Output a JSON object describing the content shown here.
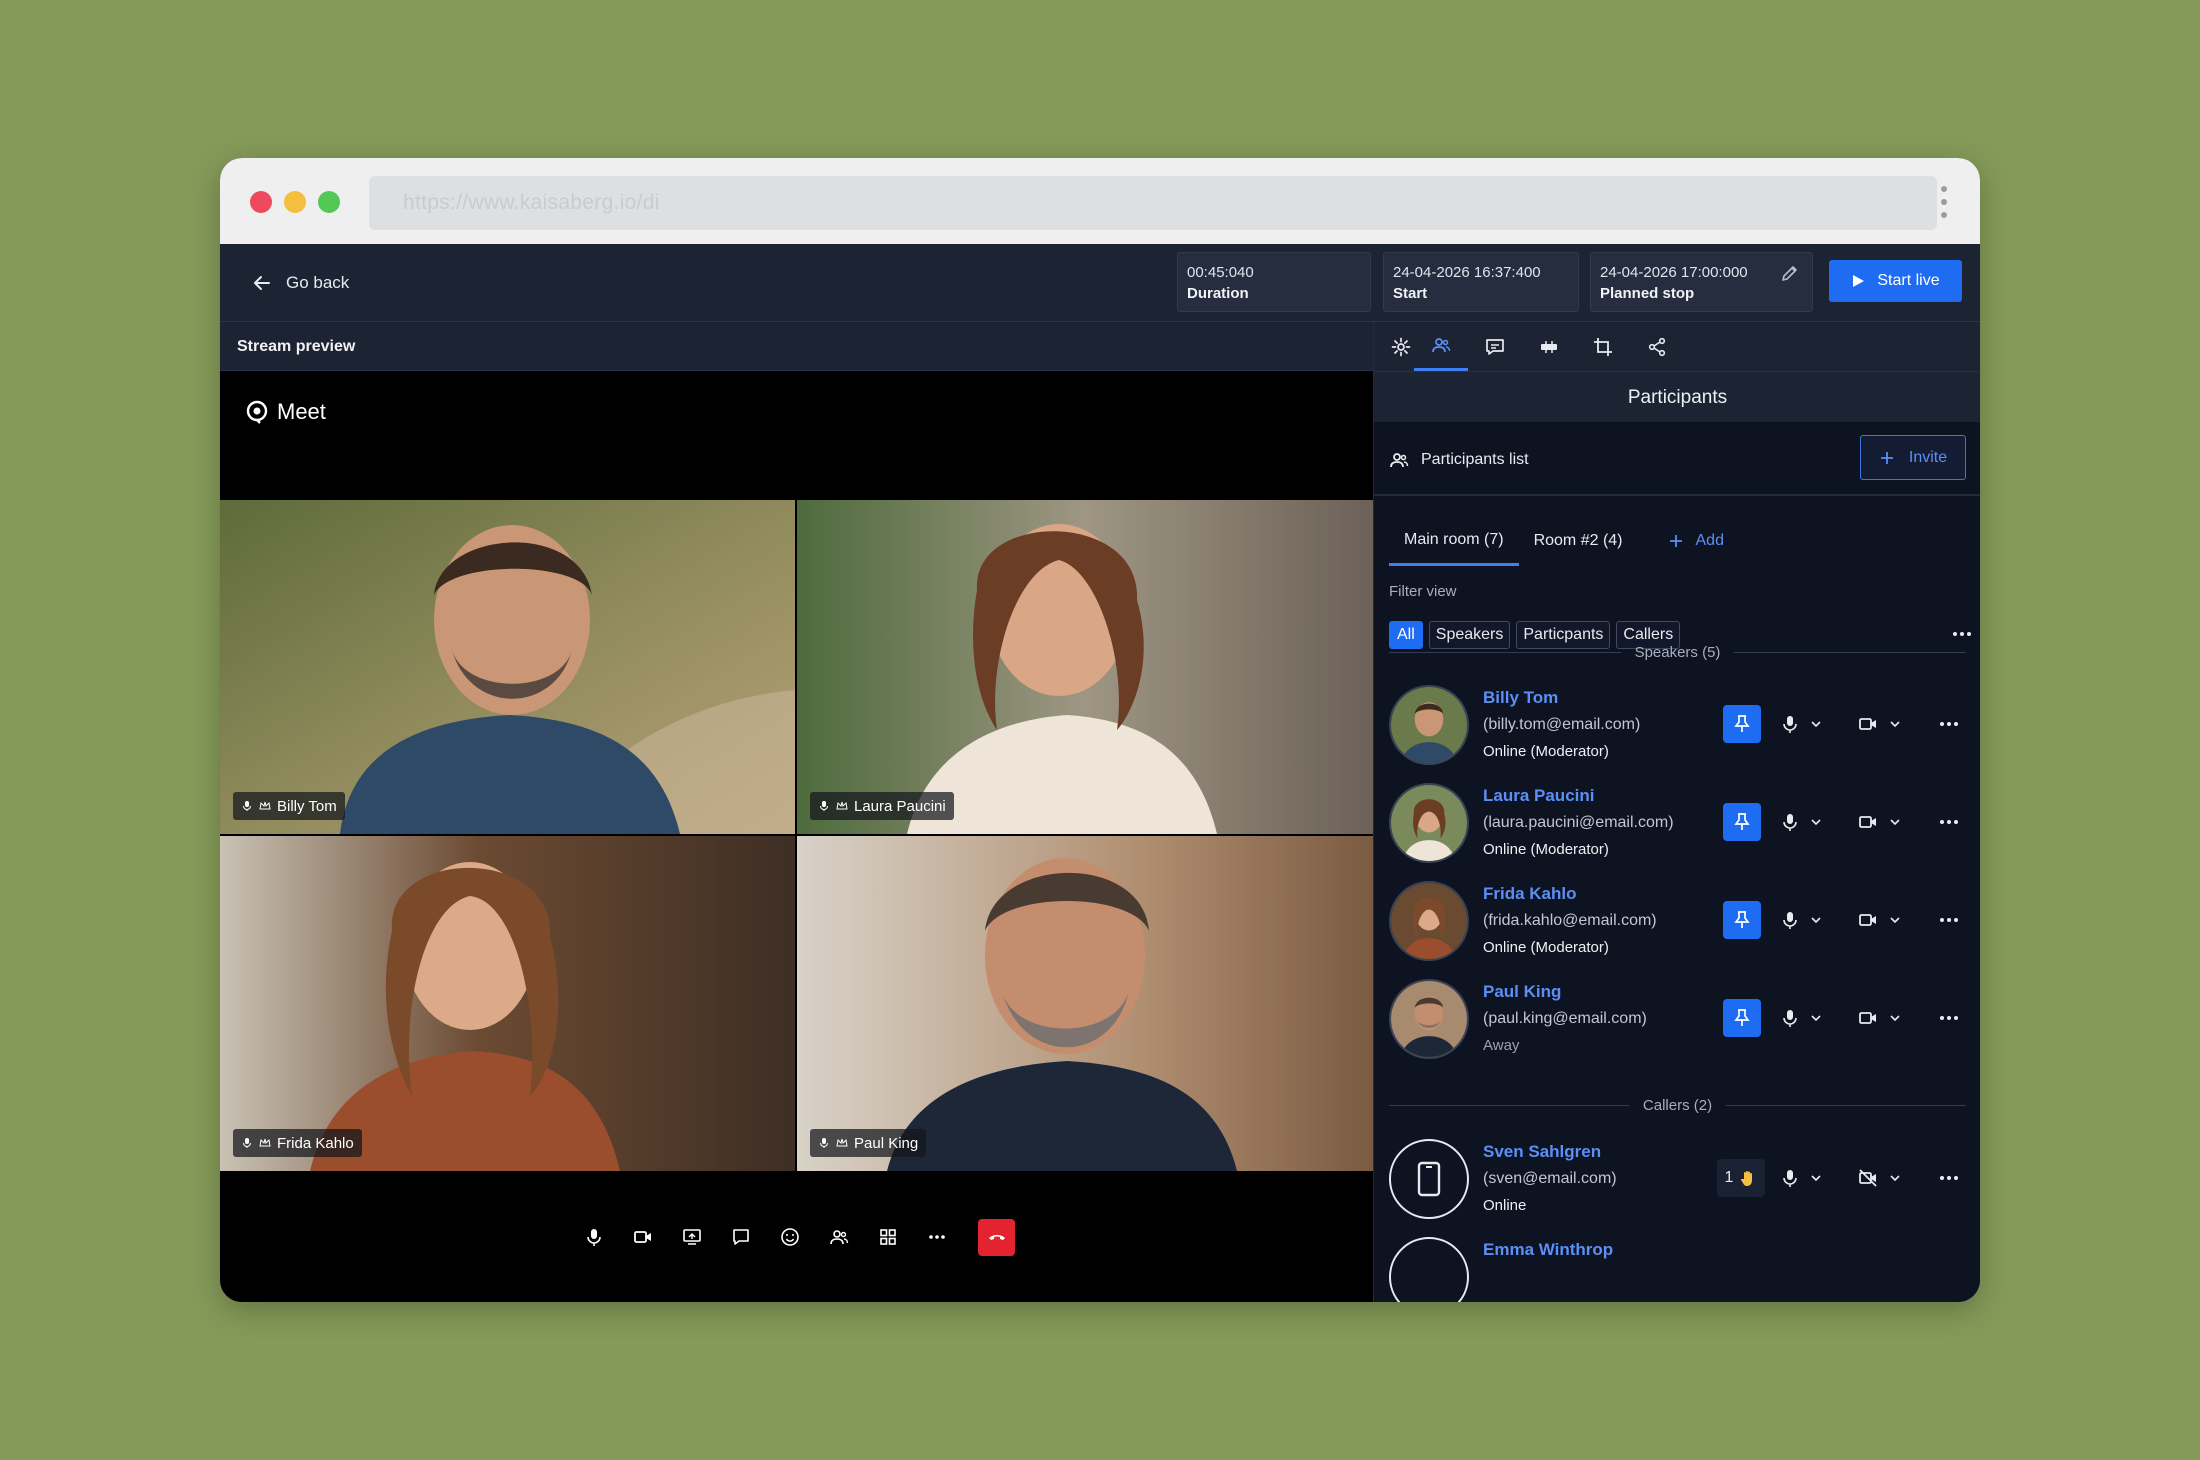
{
  "browser": {
    "url": "https://www.kaisaberg.io/di"
  },
  "topbar": {
    "go_back": "Go back",
    "duration_value": "00:45:040",
    "duration_label": "Duration",
    "start_value": "24-04-2026 16:37:400",
    "start_label": "Start",
    "stop_value": "24-04-2026 17:00:000",
    "stop_label": "Planned stop",
    "start_live": "Start live"
  },
  "preview": {
    "header": "Stream preview",
    "app_name": "Meet",
    "tiles": [
      {
        "name": "Billy Tom"
      },
      {
        "name": "Laura Paucini"
      },
      {
        "name": "Frida Kahlo"
      },
      {
        "name": "Paul King"
      }
    ]
  },
  "panel": {
    "title": "Participants",
    "list_label": "Participants list",
    "invite": "Invite",
    "rooms": [
      "Main room (7)",
      "Room #2 (4)"
    ],
    "add_room": "Add",
    "filter_label": "Filter view",
    "filters": [
      "All",
      "Speakers",
      "Particpants",
      "Callers"
    ],
    "speakers_header": "Speakers (5)",
    "callers_header": "Callers (2)",
    "speakers": [
      {
        "name": "Billy Tom",
        "email": "(billy.tom@email.com)",
        "status": "Online (Moderator)"
      },
      {
        "name": "Laura Paucini",
        "email": "(laura.paucini@email.com)",
        "status": "Online (Moderator)"
      },
      {
        "name": "Frida Kahlo",
        "email": "(frida.kahlo@email.com)",
        "status": "Online (Moderator)"
      },
      {
        "name": "Paul King",
        "email": "(paul.king@email.com)",
        "status": "Away"
      }
    ],
    "callers": [
      {
        "name": "Sven Sahlgren",
        "email": "(sven@email.com)",
        "status": "Online",
        "hand_count": "1"
      },
      {
        "name": "Emma Winthrop"
      }
    ]
  },
  "colors": {
    "accent": "#1e6cf2",
    "link": "#5b8ff5",
    "hangup": "#e3232f",
    "background": "#859a59"
  }
}
